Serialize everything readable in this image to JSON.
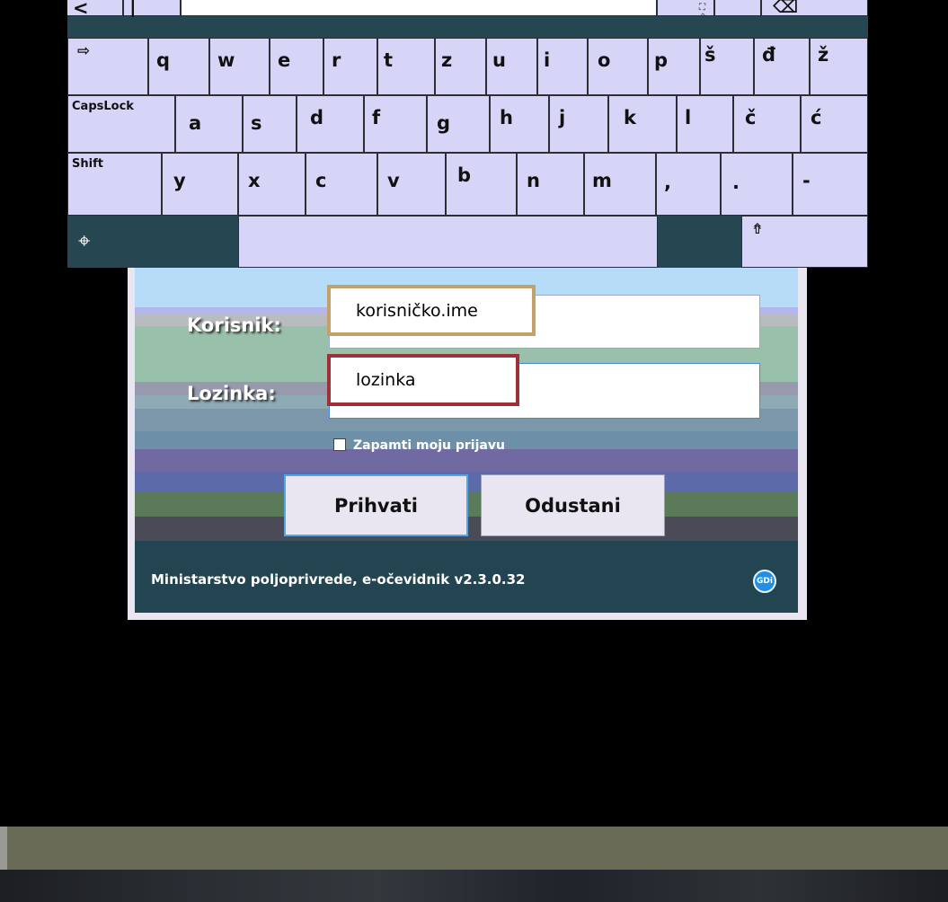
{
  "login": {
    "user_label": "Korisnik:",
    "pass_label": "Lozinka:",
    "user_callout": "korisničko.ime",
    "pass_callout": "lozinka",
    "remember_label": "Zapamti moju prijavu",
    "remember_checked": false,
    "accept_button": "Prihvati",
    "cancel_button": "Odustani",
    "footer_text": "Ministarstvo poljoprivrede, e-očevidnik v2.3.0.32",
    "footer_logo_text": "GDi",
    "callout_colors": {
      "user": "#c4a06a",
      "pass": "#9e3038"
    }
  },
  "keyboard": {
    "row1": [
      "<",
      "",
      "",
      "",
      "",
      "",
      "",
      "",
      "",
      "",
      "",
      "",
      "",
      ""
    ],
    "tab_key": "tab-arrow",
    "row2": [
      "q",
      "w",
      "e",
      "r",
      "t",
      "z",
      "u",
      "i",
      "o",
      "p",
      "š",
      "đ",
      "ž"
    ],
    "caps_label": "CapsLock",
    "row3": [
      "a",
      "s",
      "d",
      "f",
      "g",
      "h",
      "j",
      "k",
      "l",
      "č",
      "ć"
    ],
    "shift_label": "Shift",
    "row4": [
      "y",
      "x",
      "c",
      "v",
      "b",
      "n",
      "m",
      ",",
      ".",
      "-"
    ],
    "move_icon": "crosshair-icon",
    "layout_icon": "keyboard-layout-icon",
    "backspace_icon": "backspace-icon",
    "expand_icon": "expand-icon"
  }
}
